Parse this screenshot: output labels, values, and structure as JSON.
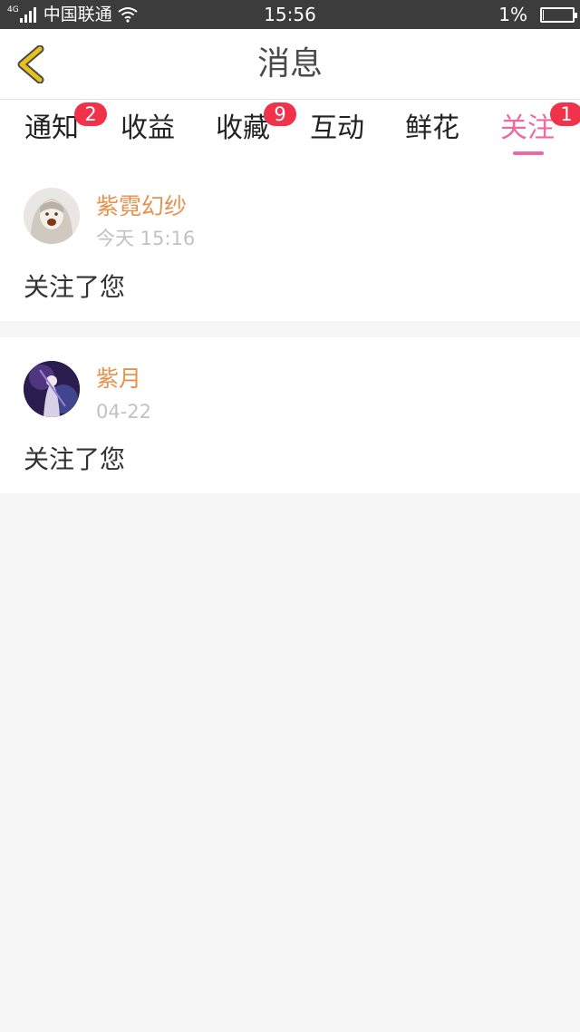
{
  "status_bar": {
    "network": "4G",
    "carrier": "中国联通",
    "time": "15:56",
    "battery_percent_text": "1%",
    "battery_level": 0.01
  },
  "header": {
    "back_icon": "chevron-left-icon",
    "title": "消息"
  },
  "tabs": [
    {
      "label": "通知",
      "badge": "2"
    },
    {
      "label": "收益",
      "badge": ""
    },
    {
      "label": "收藏",
      "badge": "9"
    },
    {
      "label": "互动",
      "badge": ""
    },
    {
      "label": "鲜花",
      "badge": ""
    },
    {
      "label": "关注",
      "badge": "1"
    }
  ],
  "active_tab": "关注",
  "messages": [
    {
      "name": "紫霓幻纱",
      "time": "今天 15:16",
      "text": "关注了您"
    },
    {
      "name": "紫月",
      "time": "04-22",
      "text": "关注了您"
    }
  ],
  "colors": {
    "accent": "#ec6aa0",
    "badge": "#f0334a",
    "username": "#e6924f",
    "back_icon": "#e8c21a"
  }
}
